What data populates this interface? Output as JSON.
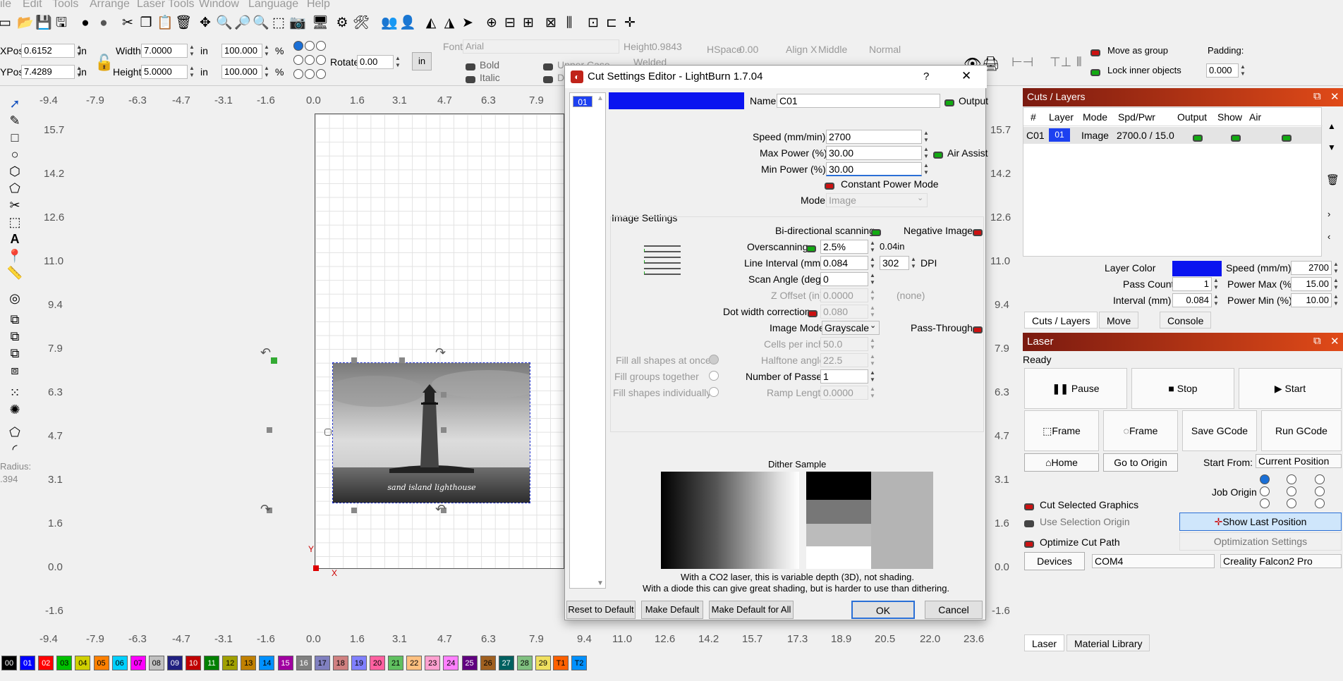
{
  "menu": [
    "ile",
    "Edit",
    "Tools",
    "Arrange",
    "Laser Tools",
    "Window",
    "Language",
    "Help"
  ],
  "props": {
    "xpos_label": "XPos",
    "xpos": "0.6152",
    "ypos_label": "YPos",
    "ypos": "7.4289",
    "unit": "in",
    "width_label": "Width",
    "width": "7.0000",
    "height_label": "Height",
    "height": "5.0000",
    "scale_w": "100.000",
    "scale_h": "100.000",
    "pct": "%",
    "rotate_label": "Rotate",
    "rotate": "0.00",
    "in_btn": "in"
  },
  "font": {
    "font_label": "Font",
    "font": "Arial",
    "height_label": "Height",
    "height": "0.9843",
    "hspace_label": "HSpace",
    "hspace": "0.00",
    "alignx_label": "Align X",
    "alignx": "Middle",
    "style": "Normal",
    "bold": "Bold",
    "italic": "Italic",
    "upper": "Upper Case",
    "welded": "Welded",
    "d": "D"
  },
  "group": {
    "move_as_group": "Move as group",
    "lock_inner": "Lock inner objects",
    "padding_label": "Padding:",
    "padding": "0.000"
  },
  "ruler": {
    "top": [
      "-9.4",
      "-7.9",
      "-6.3",
      "-4.7",
      "-3.1",
      "-1.6",
      "0.0",
      "1.6",
      "3.1",
      "4.7",
      "6.3",
      "7.9"
    ],
    "bottom": [
      "-9.4",
      "-7.9",
      "-6.3",
      "-4.7",
      "-3.1",
      "-1.6",
      "0.0",
      "1.6",
      "3.1",
      "4.7",
      "6.3",
      "7.9",
      "9.4",
      "11.0",
      "12.6",
      "14.2",
      "15.7",
      "17.3",
      "18.9",
      "20.5",
      "22.0",
      "23.6"
    ],
    "left": [
      "15.7",
      "14.2",
      "12.6",
      "11.0",
      "9.4",
      "7.9",
      "6.3",
      "4.7",
      "3.1",
      "1.6",
      "0.0",
      "-1.6"
    ],
    "right": [
      "15.7",
      "14.2",
      "12.6",
      "11.0",
      "9.4",
      "7.9",
      "6.3",
      "4.7",
      "3.1",
      "1.6",
      "0.0",
      "-1.6"
    ],
    "x": "X",
    "y": "Y"
  },
  "radius": {
    "label": "Radius:",
    "value": ".394"
  },
  "photo_caption": "sand island lighthouse",
  "dialog": {
    "title": "Cut Settings Editor - LightBurn 1.7.04",
    "help": "?",
    "close": "✕",
    "layer_chip": "01",
    "name_label": "Name",
    "name": "C01",
    "output": "Output",
    "speed_label": "Speed (mm/min)",
    "speed": "2700",
    "maxp_label": "Max Power (%)",
    "maxp": "30.00",
    "air": "Air Assist",
    "minp_label": "Min Power (%)",
    "minp": "30.00",
    "const_power": "Constant Power Mode",
    "mode_label": "Mode",
    "mode": "Image",
    "image_settings": "Image Settings",
    "bidir": "Bi-directional scanning",
    "negative": "Negative Image",
    "overscan_label": "Overscanning",
    "overscan": "2.5%",
    "overscan_in": "0.04in",
    "interval_label": "Line Interval (mm)",
    "interval": "0.084",
    "dpi": "302",
    "dpi_label": "DPI",
    "angle_label": "Scan Angle (deg)",
    "angle": "0",
    "zoff_label": "Z Offset (in)",
    "zoff": "0.0000",
    "none": "(none)",
    "dot_label": "Dot width correction",
    "dot": "0.080",
    "imgmode_label": "Image Mode",
    "imgmode": "Grayscale",
    "pass_through": "Pass-Through",
    "cells_label": "Cells per inch",
    "cells": "50.0",
    "halftone_label": "Halftone angle",
    "halftone": "22.5",
    "passes_label": "Number of Passes",
    "passes": "1",
    "ramp_label": "Ramp Length",
    "ramp": "0.0000",
    "fill_all": "Fill all shapes at once",
    "fill_groups": "Fill groups together",
    "fill_ind": "Fill shapes individually",
    "dither_title": "Dither Sample",
    "dither_note1": "With a CO2 laser, this is variable depth (3D), not shading.",
    "dither_note2": "With a diode this can give great shading, but is harder to use than dithering.",
    "reset": "Reset to Default",
    "make_default": "Make Default",
    "make_all": "Make Default for All",
    "ok": "OK",
    "cancel": "Cancel"
  },
  "cuts": {
    "title": "Cuts / Layers",
    "cols": [
      "#",
      "Layer",
      "Mode",
      "Spd/Pwr",
      "Output",
      "Show",
      "Air"
    ],
    "row": {
      "num": "C01",
      "layer": "01",
      "mode": "Image",
      "spd": "2700.0 / 15.0"
    },
    "layer_color": "Layer Color",
    "speed_label": "Speed (mm/m)",
    "speed": "2700",
    "pass_label": "Pass Count",
    "pass": "1",
    "pmax_label": "Power Max (%)",
    "pmax": "15.00",
    "interval_label": "Interval (mm)",
    "interval": "0.084",
    "pmin_label": "Power Min (%)",
    "pmin": "10.00",
    "tabs": [
      "Cuts / Layers",
      "Move",
      "Console"
    ]
  },
  "laser": {
    "title": "Laser",
    "status": "Ready",
    "pause": "Pause",
    "stop": "Stop",
    "start": "Start",
    "frame1": "Frame",
    "frame2": "Frame",
    "save_gcode": "Save GCode",
    "run_gcode": "Run GCode",
    "home": "Home",
    "go_origin": "Go to Origin",
    "start_from_label": "Start From:",
    "start_from": "Current Position",
    "job_origin": "Job Origin",
    "cut_selected": "Cut Selected Graphics",
    "use_selection": "Use Selection Origin",
    "optimize": "Optimize Cut Path",
    "show_last": "Show Last Position",
    "opt_settings": "Optimization Settings",
    "devices": "Devices",
    "port": "COM4",
    "device": "Creality Falcon2 Pro",
    "tabs": [
      "Laser",
      "Material Library"
    ]
  },
  "palette": [
    {
      "l": "00",
      "c": "#000000"
    },
    {
      "l": "01",
      "c": "#0000ff"
    },
    {
      "l": "02",
      "c": "#ff0000"
    },
    {
      "l": "03",
      "c": "#00c000"
    },
    {
      "l": "04",
      "c": "#d0d000"
    },
    {
      "l": "05",
      "c": "#ff8000"
    },
    {
      "l": "06",
      "c": "#00d0ff"
    },
    {
      "l": "07",
      "c": "#ff00ff"
    },
    {
      "l": "08",
      "c": "#c0c0c0"
    },
    {
      "l": "09",
      "c": "#202080"
    },
    {
      "l": "10",
      "c": "#c00000"
    },
    {
      "l": "11",
      "c": "#008000"
    },
    {
      "l": "12",
      "c": "#a0a000"
    },
    {
      "l": "13",
      "c": "#c08000"
    },
    {
      "l": "14",
      "c": "#0090ff"
    },
    {
      "l": "15",
      "c": "#a000a0"
    },
    {
      "l": "16",
      "c": "#808080"
    },
    {
      "l": "17",
      "c": "#8080c0"
    },
    {
      "l": "18",
      "c": "#d08080"
    },
    {
      "l": "19",
      "c": "#8080ff"
    },
    {
      "l": "20",
      "c": "#ff60a0"
    },
    {
      "l": "21",
      "c": "#60c060"
    },
    {
      "l": "22",
      "c": "#ffc080"
    },
    {
      "l": "23",
      "c": "#ffa0d0"
    },
    {
      "l": "24",
      "c": "#ff80ff"
    },
    {
      "l": "25",
      "c": "#600080"
    },
    {
      "l": "26",
      "c": "#a06020"
    },
    {
      "l": "27",
      "c": "#006060"
    },
    {
      "l": "28",
      "c": "#80c080"
    },
    {
      "l": "29",
      "c": "#f0e060"
    },
    {
      "l": "T1",
      "c": "#ff6000"
    },
    {
      "l": "T2",
      "c": "#0090ff"
    }
  ]
}
